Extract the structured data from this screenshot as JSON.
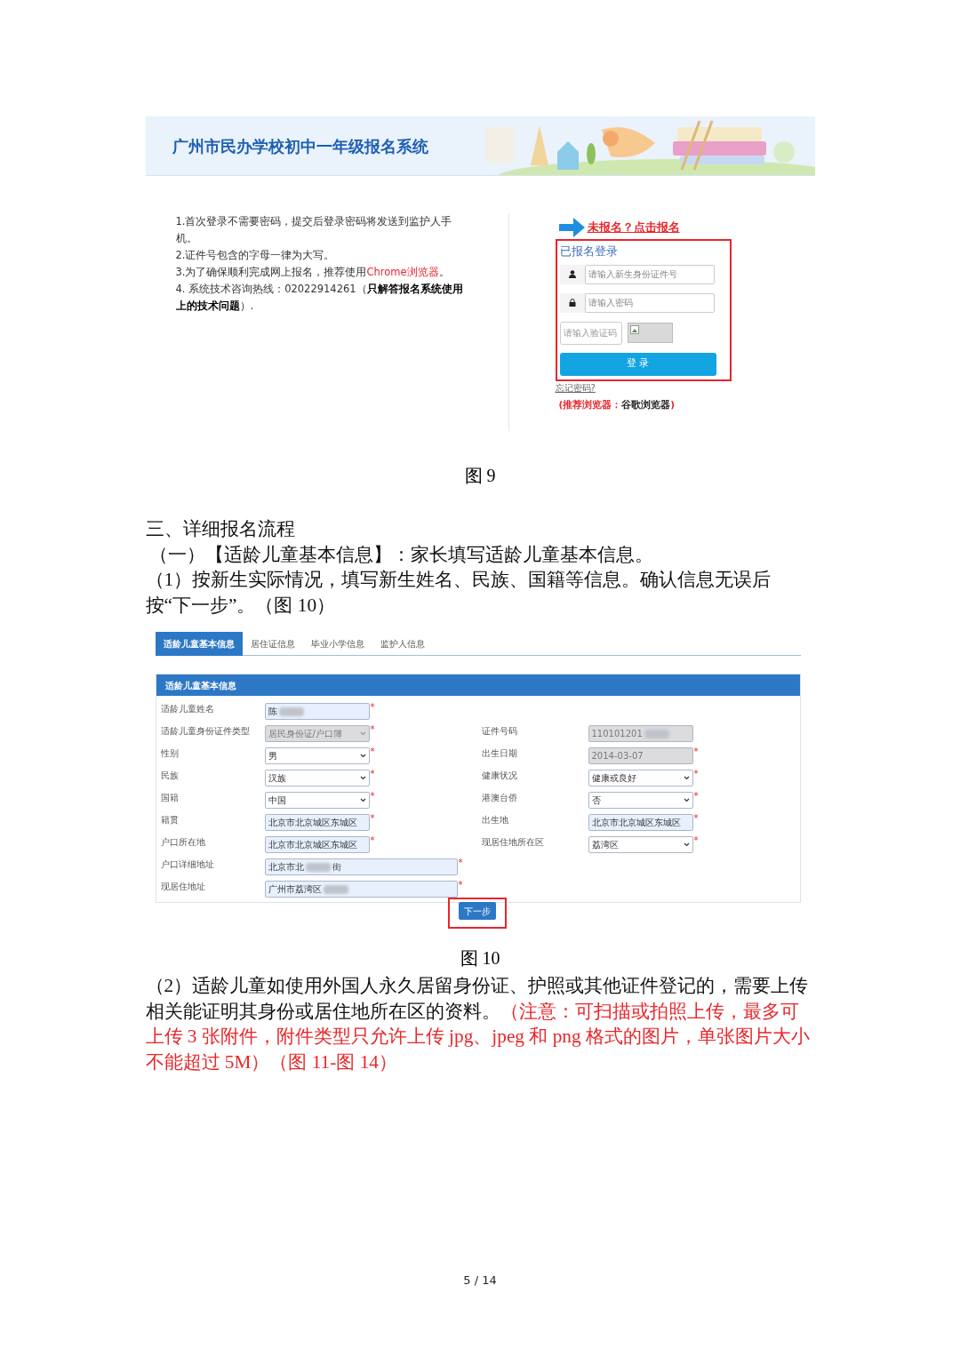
{
  "banner": {
    "title": "广州市民办学校初中一年级报名系统"
  },
  "login_figure": {
    "notes": [
      [
        {
          "text": "1.首次登录不需要密码，提交后登录密码将发送到监护人手机。",
          "kind": "plain"
        }
      ],
      [
        {
          "text": "2.证件号包含的字母一律为大写。",
          "kind": "plain"
        }
      ],
      [
        {
          "text": "3.为了确保顺利完成网上报名，推荐使用",
          "kind": "plain"
        },
        {
          "text": "Chrome浏览器",
          "kind": "red"
        },
        {
          "text": "。",
          "kind": "plain"
        }
      ],
      [
        {
          "text": "4. 系统技术咨询热线：02022914261（",
          "kind": "plain"
        },
        {
          "text": "只解答报名系统使用上的技术问题",
          "kind": "bold"
        },
        {
          "text": "）.",
          "kind": "plain"
        }
      ]
    ],
    "register_link": "未报名？点击报名",
    "login_title": "已报名登录",
    "id_field": {
      "placeholder": "请输入新生身份证件号"
    },
    "password_field": {
      "placeholder": "请输入密码"
    },
    "captcha_field": {
      "placeholder": "请输入验证码"
    },
    "login_button": "登 录",
    "forgot_link": "忘记密码?",
    "browser_note": [
      {
        "text": "(推荐浏览器：",
        "kind": "red"
      },
      {
        "text": "谷歌浏览器",
        "kind": "plain"
      },
      {
        "text": ")",
        "kind": "red"
      }
    ]
  },
  "caption_1": "图 9",
  "section_heading": "三、详细报名流程",
  "step_heading": "（一）【适龄儿童基本信息】：家长填写适龄儿童基本信息。",
  "step_text": "（1）按新生实际情况，填写新生姓名、民族、国籍等信息。确认信息无误后按“下一步”。（图 10）",
  "form_figure": {
    "tabs": [
      {
        "label": "适龄儿童基本信息",
        "selected": true
      },
      {
        "label": "居住证信息",
        "selected": false
      },
      {
        "label": "毕业小学信息",
        "selected": false
      },
      {
        "label": "监护人信息",
        "selected": false
      }
    ],
    "panel_title": "适龄儿童基本信息",
    "left_fields": [
      {
        "label": "适龄儿童姓名",
        "value": "陈",
        "kind": "input",
        "disabled": false,
        "blurred": true,
        "required_mark": "*"
      },
      {
        "label": "适龄儿童身份证件类型",
        "value": "居民身份证/户口簿",
        "kind": "select",
        "disabled": true,
        "blurred": false,
        "required_mark": "*"
      },
      {
        "label": "性别",
        "value": "男",
        "kind": "select",
        "disabled": false,
        "blurred": false,
        "required_mark": "*"
      },
      {
        "label": "民族",
        "value": "汉族",
        "kind": "select",
        "disabled": false,
        "blurred": false,
        "required_mark": "*"
      },
      {
        "label": "国籍",
        "value": "中国",
        "kind": "select",
        "disabled": false,
        "blurred": false,
        "required_mark": "*"
      },
      {
        "label": "籍贯",
        "value": "北京市北京城区东城区",
        "kind": "input",
        "disabled": false,
        "blurred": false,
        "required_mark": "*"
      },
      {
        "label": "户口所在地",
        "value": "北京市北京城区东城区",
        "kind": "input",
        "disabled": false,
        "blurred": false,
        "required_mark": "*"
      },
      {
        "label": "户口详细地址",
        "value": "北京市北",
        "value_tail": "街",
        "kind": "wide_input",
        "disabled": false,
        "blurred": true,
        "required_mark": "*"
      },
      {
        "label": "现居住地址",
        "value": "广州市荔湾区",
        "kind": "wide_input",
        "disabled": false,
        "blurred": true,
        "required_mark": "*"
      }
    ],
    "right_fields": [
      {
        "label": "证件号码",
        "value": "110101201",
        "kind": "input",
        "disabled": true,
        "blurred": true
      },
      {
        "label": "出生日期",
        "value": "2014-03-07",
        "kind": "input",
        "disabled": true,
        "blurred": false,
        "required_mark": "*"
      },
      {
        "label": "健康状况",
        "value": "健康或良好",
        "kind": "select",
        "disabled": false,
        "blurred": false,
        "required_mark": "*"
      },
      {
        "label": "港澳台侨",
        "value": "否",
        "kind": "select",
        "disabled": false,
        "blurred": false,
        "required_mark": "*"
      },
      {
        "label": "出生地",
        "value": "北京市北京城区东城区",
        "kind": "input",
        "disabled": false,
        "blurred": false,
        "required_mark": "*"
      },
      {
        "label": "现居住地所在区",
        "value": "荔湾区",
        "kind": "select",
        "disabled": false,
        "blurred": false,
        "required_mark": "*"
      }
    ],
    "next_button": "下一步"
  },
  "caption_2": "图 10",
  "note_paragraph": [
    {
      "text": "（2）适龄儿童如使用外国人永久居留身份证、护照或其他证件登记的，需要上传相关能证明其身份或居住地所在区的资料。",
      "kind": "plain"
    },
    {
      "text": "（注意：可扫描或拍照上传，最多可上传 3 张附件，附件类型只允许上传 jpg、jpeg 和 png 格式的图片，单张图片大小不能超过 5M）",
      "kind": "red"
    },
    {
      "text": "（图 11-图 14）",
      "kind": "red"
    }
  ],
  "page_number": "5 / 14"
}
